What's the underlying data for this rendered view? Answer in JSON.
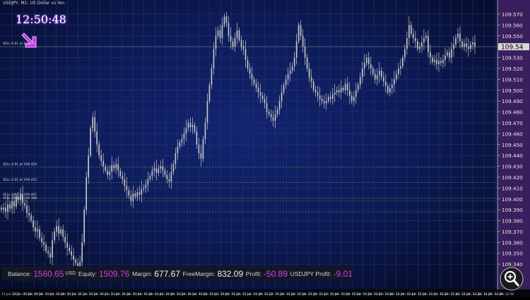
{
  "window": {
    "symbol_title": "USDJPY, M1: US Dollar vs Yen",
    "clock": "12:50:48"
  },
  "orders": [
    {
      "label": "SELL 0.01 at 109.54",
      "price": 109.54
    },
    {
      "label": "SELL 0.01 at 109.429",
      "price": 109.429
    },
    {
      "label": "SELL 0.01 at 109.415",
      "price": 109.415
    },
    {
      "label": "SELL 0.01 at 109.401",
      "price": 109.401
    },
    {
      "label": "SELL 0.01 at 109.398",
      "price": 109.398
    },
    {
      "label": "",
      "price": 109.388
    }
  ],
  "account_bar": {
    "balance_label": "Balance:",
    "balance_value": "1560.65",
    "balance_currency": "USD",
    "equity_label": "Equity:",
    "equity_value": "1509.76",
    "margin_label": "Margin:",
    "margin_value": "677.67",
    "freemargin_label": "FreeMargin:",
    "freemargin_value": "832.09",
    "profit_label": "Profit:",
    "profit_value": "-50.89",
    "symbol_profit_label": "USDJPY Profit:",
    "symbol_profit_value": "-9.01"
  },
  "colors": {
    "background": "#0a1235",
    "grid": "#2a3a6a",
    "candle": "#c8c8c8",
    "value_accent": "#d43cf0",
    "price_axis_bg": "#3a1f5e",
    "current_price_bg": "#d8d8d8",
    "order_line": "#3a8a3a",
    "bid_line": "#6a6a9a"
  },
  "icons": {
    "trend_arrow": "arrow-down-right-icon",
    "zoom": "magnifier-plus-icon"
  },
  "chart_data": {
    "type": "candlestick",
    "symbol": "USDJPY",
    "timeframe": "M1",
    "ylim": [
      109.318,
      109.583
    ],
    "current_price": "109.54",
    "y_ticks": [
      "109.340",
      "109.350",
      "109.360",
      "109.370",
      "109.380",
      "109.390",
      "109.400",
      "109.410",
      "109.420",
      "109.430",
      "109.440",
      "109.450",
      "109.460",
      "109.470",
      "109.480",
      "109.490",
      "109.500",
      "109.510",
      "109.520",
      "109.530",
      "109.540",
      "109.550",
      "109.560",
      "109.570"
    ],
    "x_ticks": [
      "11 Jun 2021",
      "11 Jun 09:54",
      "11 Jun 09:58",
      "11 Jun 10:02",
      "11 Jun 10:06",
      "11 Jun 10:10",
      "11 Jun 10:14",
      "11 Jun 10:18",
      "11 Jun 10:22",
      "11 Jun 10:26",
      "11 Jun 10:30",
      "11 Jun 10:34",
      "11 Jun 10:38",
      "11 Jun 10:42",
      "11 Jun 10:46",
      "11 Jun 10:50",
      "11 Jun 10:54",
      "11 Jun 10:58",
      "11 Jun 11:02",
      "11 Jun 11:06",
      "11 Jun 11:10",
      "11 Jun 11:14",
      "11 Jun 11:18",
      "11 Jun 11:22",
      "11 Jun 11:26",
      "11 Jun 11:30",
      "11 Jun 11:34",
      "11 Jun 11:38",
      "11 Jun 11:42",
      "11 Jun 11:46",
      "11 Jun 11:50",
      "11 Jun 11:54",
      "11 Jun 11:58",
      "11 Jun 12:02",
      "11 Jun 12:06",
      "11 Jun 12:10",
      "11 Jun 12:14",
      "11 Jun 12:18",
      "11 Jun 12:22",
      "11 Jun 12:26",
      "11 Jun 12:30",
      "11 Jun 12:34",
      "11 Jun 12:38",
      "11 Jun 12:42",
      "11 Jun 12:46",
      "11 Jun 12:50"
    ],
    "closes": [
      109.39,
      109.392,
      109.388,
      109.395,
      109.391,
      109.398,
      109.393,
      109.402,
      109.399,
      109.404,
      109.396,
      109.394,
      109.387,
      109.385,
      109.38,
      109.374,
      109.37,
      109.372,
      109.364,
      109.36,
      109.358,
      109.352,
      109.35,
      109.346,
      109.362,
      109.37,
      109.375,
      109.368,
      109.372,
      109.365,
      109.36,
      109.355,
      109.352,
      109.348,
      109.344,
      109.341,
      109.338,
      109.342,
      109.36,
      109.39,
      109.42,
      109.44,
      109.465,
      109.475,
      109.462,
      109.45,
      109.44,
      109.435,
      109.43,
      109.426,
      109.422,
      109.425,
      109.431,
      109.428,
      109.432,
      109.426,
      109.421,
      109.418,
      109.412,
      109.408,
      109.403,
      109.398,
      109.405,
      109.402,
      109.406,
      109.404,
      109.409,
      109.41,
      109.413,
      109.418,
      109.421,
      109.426,
      109.428,
      109.424,
      109.428,
      109.43,
      109.426,
      109.422,
      109.418,
      109.416,
      109.425,
      109.432,
      109.442,
      109.448,
      109.452,
      109.455,
      109.46,
      109.465,
      109.47,
      109.466,
      109.468,
      109.462,
      109.45,
      109.442,
      109.437,
      109.455,
      109.47,
      109.49,
      109.505,
      109.52,
      109.538,
      109.55,
      109.555,
      109.548,
      109.56,
      109.568,
      109.562,
      109.55,
      109.545,
      109.54,
      109.548,
      109.555,
      109.546,
      109.54,
      109.538,
      109.528,
      109.52,
      109.515,
      109.51,
      109.506,
      109.502,
      109.498,
      109.495,
      109.492,
      109.488,
      109.48,
      109.478,
      109.475,
      109.472,
      109.478,
      109.482,
      109.49,
      109.498,
      109.505,
      109.51,
      109.515,
      109.518,
      109.522,
      109.53,
      109.545,
      109.56,
      109.55,
      109.54,
      109.53,
      109.52,
      109.512,
      109.508,
      109.5,
      109.498,
      109.495,
      109.492,
      109.49,
      109.488,
      109.49,
      109.494,
      109.492,
      109.496,
      109.498,
      109.5,
      109.498,
      109.502,
      109.5,
      109.506,
      109.5,
      109.495,
      109.49,
      109.494,
      109.5,
      109.505,
      109.512,
      109.52,
      109.525,
      109.53,
      109.524,
      109.52,
      109.515,
      109.51,
      109.514,
      109.518,
      109.512,
      109.508,
      109.504,
      109.498,
      109.502,
      109.505,
      109.51,
      109.515,
      109.52,
      109.522,
      109.53,
      109.538,
      109.548,
      109.56,
      109.552,
      109.548,
      109.545,
      109.538,
      109.54,
      109.544,
      109.548,
      109.55,
      109.535,
      109.53,
      109.526,
      109.528,
      109.524,
      109.527,
      109.525,
      109.528,
      109.532,
      109.535,
      109.53,
      109.538,
      109.542,
      109.548,
      109.552,
      109.545,
      109.54,
      109.543,
      109.54,
      109.538,
      109.542,
      109.544,
      109.54
    ]
  }
}
